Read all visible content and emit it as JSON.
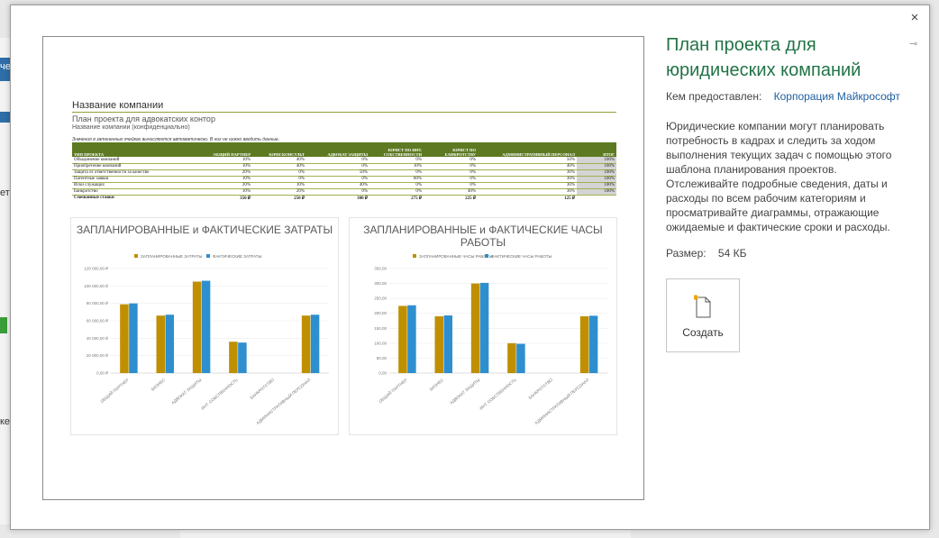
{
  "background": {
    "side_text_1": "чес",
    "side_text_2": "ет",
    "side_text_3": "ке"
  },
  "dialog": {
    "close_icon": "×",
    "pin_icon": "⊸",
    "title": "План проекта для юридических компаний",
    "provider_label": "Кем предоставлен:",
    "provider_value": "Корпорация Майкрософт",
    "description": "Юридические компании могут планировать потребность в кадрах и следить за ходом выполнения текущих задач с помощью этого шаблона планирования проектов. Отслеживайте подробные сведения, даты и расходы по всем рабочим категориям и просматривайте диаграммы, отражающие ожидаемые и фактические сроки и расходы.",
    "size_label": "Размер:",
    "size_value": "54 КБ",
    "create_label": "Создать"
  },
  "preview": {
    "company": "Название компании",
    "subtitle": "План проекта для адвокатских контор",
    "subtitle2": "Название компании (конфиденциально)",
    "note": "Значения в затененных ячейках вычисляются автоматически. В них не нужно вводить данные.",
    "headers": [
      "ТИП ПРОЕКТА",
      "ОБЩИЙ ПАРТНЕР",
      "ЮРИСКОНСУЛЬТ",
      "АДВОКАТ ЗАЩИТЫ",
      "ЮРИСТ ПО ИНТ. СОБСТВЕННОСТИ",
      "ЮРИСТ ПО БАНКРОТСТВУ",
      "АДМИНИСТРАТИВНЫЙ ПЕРСОНАЛ",
      "ИТОГ"
    ],
    "rows": [
      [
        "Объединение компаний",
        "10%",
        "40%",
        "0%",
        "0%",
        "0%",
        "50%",
        "100%"
      ],
      [
        "Приобретение компаний",
        "10%",
        "40%",
        "0%",
        "10%",
        "0%",
        "40%",
        "100%"
      ],
      [
        "Защита от ответственности за качество",
        "20%",
        "0%",
        "50%",
        "0%",
        "0%",
        "30%",
        "100%"
      ],
      [
        "Патентные заявки",
        "10%",
        "0%",
        "0%",
        "60%",
        "0%",
        "30%",
        "100%"
      ],
      [
        "Иски служащих",
        "20%",
        "10%",
        "40%",
        "0%",
        "0%",
        "30%",
        "100%"
      ],
      [
        "Банкротство",
        "10%",
        "20%",
        "0%",
        "0%",
        "40%",
        "30%",
        "100%"
      ]
    ],
    "total_row": [
      "Смешанные ставки",
      "350 ₽",
      "250 ₽",
      "300 ₽",
      "275 ₽",
      "225 ₽",
      "125 ₽",
      ""
    ]
  },
  "chart_data": [
    {
      "type": "bar",
      "title": "ЗАПЛАНИРОВАННЫЕ и ФАКТИЧЕСКИЕ ЗАТРАТЫ",
      "categories": [
        "ОБЩИЙ ПАРТНЕР",
        "БИЗНЕС",
        "АДВОКАТ ЗАЩИТЫ",
        "ИНТ. СОБСТВЕННОСТЬ",
        "БАНКРОТСТВО",
        "АДМИНИСТРАТИВНЫЙ ПЕРСОНАЛ"
      ],
      "series": [
        {
          "name": "ЗАПЛАНИРОВАННЫЕ ЗАТРАТЫ",
          "color": "#bf8f00",
          "values": [
            79000,
            66000,
            105000,
            36000,
            0,
            66000
          ]
        },
        {
          "name": "ФАКТИЧЕСКИЕ ЗАТРАТЫ",
          "color": "#2e8fcf",
          "values": [
            80000,
            67000,
            106000,
            35000,
            0,
            67000
          ]
        }
      ],
      "yticks": [
        "0,00 ₽",
        "20 000,00 ₽",
        "40 000,00 ₽",
        "60 000,00 ₽",
        "80 000,00 ₽",
        "100 000,00 ₽",
        "120 000,00 ₽"
      ],
      "ylim": [
        0,
        120000
      ],
      "legend": "top"
    },
    {
      "type": "bar",
      "title": "ЗАПЛАНИРОВАННЫЕ и ФАКТИЧЕСКИЕ ЧАСЫ РАБОТЫ",
      "categories": [
        "ОБЩИЙ ПАРТНЕР",
        "БИЗНЕС",
        "АДВОКАТ ЗАЩИТЫ",
        "ИНТ. СОБСТВЕННОСТЬ",
        "БАНКРОТСТВО",
        "АДМИНИСТРАТИВНЫЙ ПЕРСОНАЛ"
      ],
      "series": [
        {
          "name": "ЗАПЛАНИРОВАННЫЕ ЧАСЫ РАБОТЫ",
          "color": "#bf8f00",
          "values": [
            225,
            190,
            300,
            100,
            0,
            190
          ]
        },
        {
          "name": "ФАКТИЧЕСКИЕ ЧАСЫ РАБОТЫ",
          "color": "#2e8fcf",
          "values": [
            227,
            193,
            302,
            98,
            0,
            192
          ]
        }
      ],
      "yticks": [
        "0,00",
        "50,00",
        "100,00",
        "150,00",
        "200,00",
        "250,00",
        "300,00",
        "350,00"
      ],
      "ylim": [
        0,
        350
      ],
      "legend": "top"
    }
  ]
}
